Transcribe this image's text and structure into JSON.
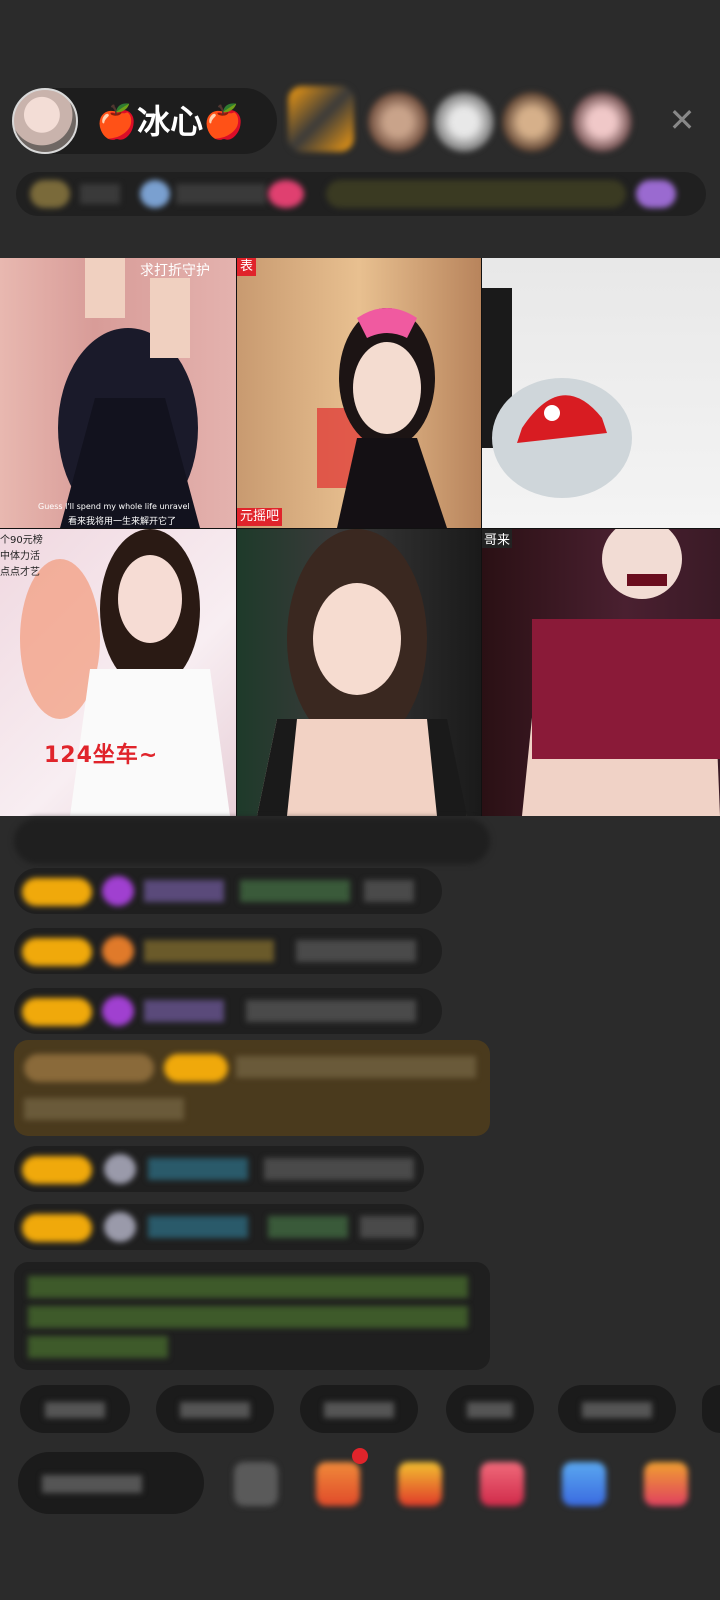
{
  "header": {
    "host_name": "🍎冰心🍎",
    "viewers_count": 5
  },
  "grid": {
    "tiles": [
      {
        "caption_top": "求打折守护",
        "caption_bottom": "Guess I'll spend my whole life unravel",
        "caption_bottom_cn": "看来我将用一生来解开它了"
      },
      {
        "tag_bottom": "元摇吧"
      },
      {},
      {
        "caption_top": "个90元榜",
        "caption_top2": "中体力活",
        "caption_top3": "点点才艺",
        "big_text": "124坐车~"
      },
      {},
      {
        "tag_top": "哥来"
      }
    ]
  },
  "colors": {
    "background": "#2b2b2b",
    "badge": "#f0a90b",
    "accent_red": "#e0242b",
    "notice_green": "#8cc63f",
    "name_cyan": "#3fb6c9",
    "name_purple": "#9b6ddb"
  },
  "icons": [
    "close-icon",
    "gift-icon",
    "red-packet-icon",
    "game-icon",
    "share-icon",
    "more-icon"
  ]
}
